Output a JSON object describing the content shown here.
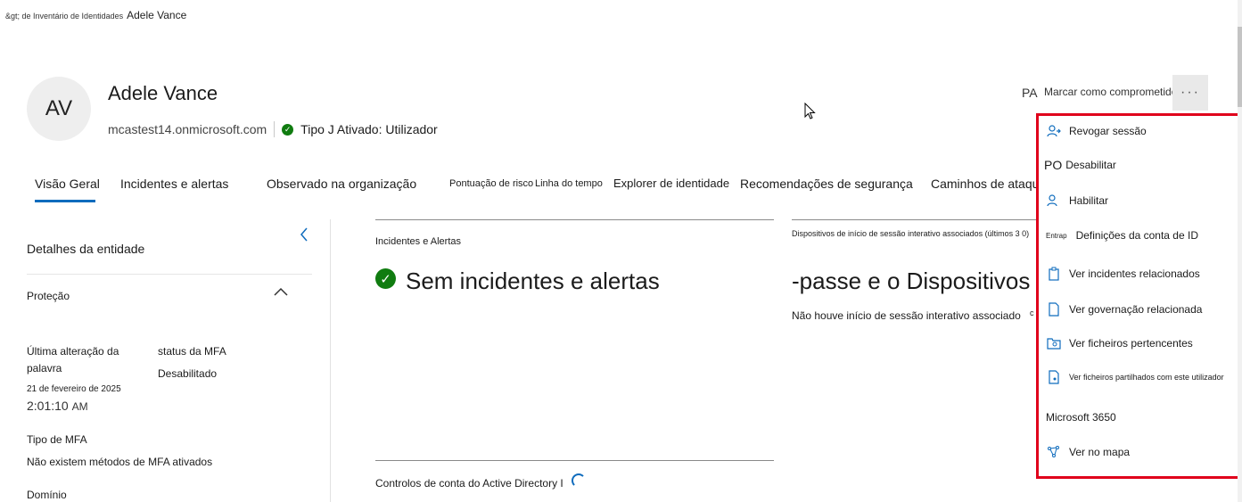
{
  "breadcrumb": {
    "parent": "&gt; de Inventário de Identidades",
    "current": "Adele Vance"
  },
  "user": {
    "initials": "AV",
    "name": "Adele Vance",
    "domain": "mcastest14.onmicrosoft.com",
    "status": "Tipo J Ativado: Utilizador"
  },
  "header_actions": {
    "pa_badge": "PA",
    "mark_compromised": "Marcar como comprometido",
    "more": "···"
  },
  "tabs": [
    {
      "label": "Visão Geral",
      "active": true
    },
    {
      "label": "Incidentes e alertas"
    },
    {
      "label": "Observado na organização"
    },
    {
      "label": "Pontuação de risco"
    },
    {
      "label": "Linha do tempo"
    },
    {
      "label": "Explorer de identidade"
    },
    {
      "label": "Recomendações de segurança"
    },
    {
      "label": "Caminhos de ataque"
    }
  ],
  "entity_panel": {
    "title": "Detalhes da entidade",
    "section": "Proteção",
    "last_change_label_1": "Última alteração da",
    "last_change_label_2": "palavra",
    "last_change_date": "21 de fevereiro de 2025",
    "last_change_time": "2:01:10",
    "last_change_ampm": "AM",
    "mfa_status_label": "status da MFA",
    "mfa_status_value": "Desabilitado",
    "mfa_type_label": "Tipo de MFA",
    "mfa_type_value": "Não existem métodos de MFA ativados",
    "domain_label": "Domínio"
  },
  "incidents_card": {
    "title": "Incidentes e Alertas",
    "message": "Sem incidentes e alertas"
  },
  "devices_card": {
    "title": "Dispositivos de início de sessão interativo associados (últimos 3 0)",
    "big_text": "-passe e o Dispositivos",
    "message": "Não houve início de sessão interativo associado",
    "cut": "c"
  },
  "ad_card": {
    "title": "Controlos de conta do Active Directory I"
  },
  "menu": {
    "revoke": "Revogar sessão",
    "po_badge": "PO",
    "disable": "Desabilitar",
    "enable": "Habilitar",
    "entra_tag": "Entrap",
    "id_settings": "Definições da conta de ID",
    "related_incidents": "Ver incidentes relacionados",
    "related_governance": "Ver governação relacionada",
    "owned_files": "Ver ficheiros pertencentes",
    "shared_files": "Ver ficheiros partilhados com este utilizador",
    "m365_header": "Microsoft 3650",
    "view_map": "Ver no mapa"
  },
  "colors": {
    "accent": "#0f6cbd",
    "success": "#107c10",
    "highlight": "#e0001b"
  }
}
